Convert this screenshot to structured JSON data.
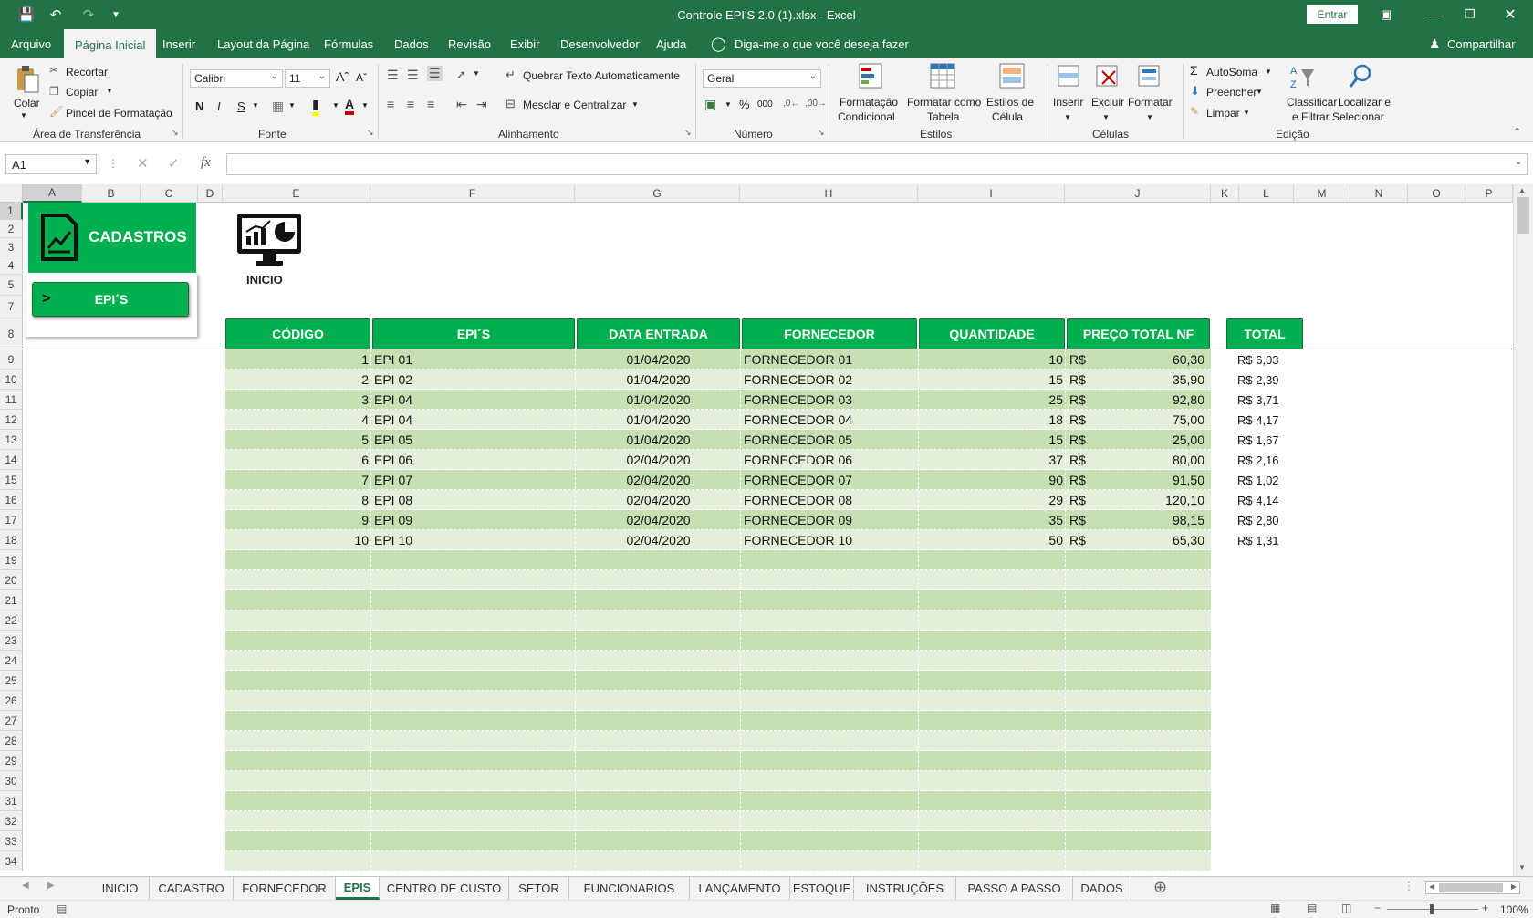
{
  "window": {
    "title": "Controle EPI'S 2.0 (1).xlsx  -  Excel",
    "sign_in": "Entrar"
  },
  "menu": {
    "tabs": [
      "Arquivo",
      "Página Inicial",
      "Inserir",
      "Layout da Página",
      "Fórmulas",
      "Dados",
      "Revisão",
      "Exibir",
      "Desenvolvedor",
      "Ajuda"
    ],
    "active_tab": "Página Inicial",
    "tell_me": "Diga-me o que você deseja fazer",
    "share": "Compartilhar"
  },
  "ribbon": {
    "clipboard": {
      "paste": "Colar",
      "cut": "Recortar",
      "copy": "Copiar",
      "format_painter": "Pincel de Formatação",
      "label": "Área de Transferência"
    },
    "font": {
      "name": "Calibri",
      "size": "11",
      "bold": "N",
      "italic": "I",
      "underline": "S",
      "label": "Fonte"
    },
    "alignment": {
      "wrap_text": "Quebrar Texto Automaticamente",
      "merge_center": "Mesclar e Centralizar",
      "label": "Alinhamento"
    },
    "number": {
      "format": "Geral",
      "percent": "%",
      "thousands": "000",
      "label": "Número"
    },
    "styles": {
      "conditional_1": "Formatação",
      "conditional_2": "Condicional",
      "table_1": "Formatar como",
      "table_2": "Tabela",
      "cell_1": "Estilos de",
      "cell_2": "Célula",
      "label": "Estilos"
    },
    "cells": {
      "insert": "Inserir",
      "delete": "Excluir",
      "format": "Formatar",
      "label": "Células"
    },
    "editing": {
      "autosum": "AutoSoma",
      "fill": "Preencher",
      "clear": "Limpar",
      "sort_1": "Classificar",
      "sort_2": "e Filtrar",
      "find_1": "Localizar e",
      "find_2": "Selecionar",
      "label": "Edição"
    }
  },
  "formula_bar": {
    "name_box": "A1",
    "fx": "fx",
    "value": ""
  },
  "columns": [
    "A",
    "B",
    "C",
    "D",
    "E",
    "F",
    "G",
    "H",
    "I",
    "J",
    "K",
    "L",
    "M",
    "N",
    "O",
    "P"
  ],
  "rows": [
    "1",
    "2",
    "3",
    "4",
    "5",
    "7",
    "8",
    "9",
    "10",
    "11",
    "12",
    "13",
    "14",
    "15",
    "16",
    "17",
    "18",
    "19",
    "20",
    "21",
    "22",
    "23",
    "24",
    "25",
    "26",
    "27",
    "28",
    "29",
    "30",
    "31",
    "32",
    "33",
    "34"
  ],
  "sidebar": {
    "title": "CADASTROS",
    "button_arrow": ">",
    "button_label": "EPI´S"
  },
  "home_button": {
    "label": "INICIO"
  },
  "table": {
    "headers": [
      "CÓDIGO",
      "EPI´S",
      "DATA ENTRADA",
      "FORNECEDOR",
      "QUANTIDADE",
      "PREÇO TOTAL NF"
    ],
    "currency": "R$",
    "rows": [
      {
        "codigo": "1",
        "epi": "EPI 01",
        "data": "01/04/2020",
        "fornecedor": "FORNECEDOR 01",
        "quantidade": "10",
        "preco": "60,30",
        "total": "R$ 6,03"
      },
      {
        "codigo": "2",
        "epi": "EPI 02",
        "data": "01/04/2020",
        "fornecedor": "FORNECEDOR 02",
        "quantidade": "15",
        "preco": "35,90",
        "total": "R$ 2,39"
      },
      {
        "codigo": "3",
        "epi": "EPI 04",
        "data": "01/04/2020",
        "fornecedor": "FORNECEDOR 03",
        "quantidade": "25",
        "preco": "92,80",
        "total": "R$ 3,71"
      },
      {
        "codigo": "4",
        "epi": "EPI 04",
        "data": "01/04/2020",
        "fornecedor": "FORNECEDOR 04",
        "quantidade": "18",
        "preco": "75,00",
        "total": "R$ 4,17"
      },
      {
        "codigo": "5",
        "epi": "EPI 05",
        "data": "01/04/2020",
        "fornecedor": "FORNECEDOR 05",
        "quantidade": "15",
        "preco": "25,00",
        "total": "R$ 1,67"
      },
      {
        "codigo": "6",
        "epi": "EPI 06",
        "data": "02/04/2020",
        "fornecedor": "FORNECEDOR 06",
        "quantidade": "37",
        "preco": "80,00",
        "total": "R$ 2,16"
      },
      {
        "codigo": "7",
        "epi": "EPI 07",
        "data": "02/04/2020",
        "fornecedor": "FORNECEDOR 07",
        "quantidade": "90",
        "preco": "91,50",
        "total": "R$ 1,02"
      },
      {
        "codigo": "8",
        "epi": "EPI 08",
        "data": "02/04/2020",
        "fornecedor": "FORNECEDOR 08",
        "quantidade": "29",
        "preco": "120,10",
        "total": "R$ 4,14"
      },
      {
        "codigo": "9",
        "epi": "EPI 09",
        "data": "02/04/2020",
        "fornecedor": "FORNECEDOR 09",
        "quantidade": "35",
        "preco": "98,15",
        "total": "R$ 2,80"
      },
      {
        "codigo": "10",
        "epi": "EPI 10",
        "data": "02/04/2020",
        "fornecedor": "FORNECEDOR 10",
        "quantidade": "50",
        "preco": "65,30",
        "total": "R$ 1,31"
      }
    ],
    "total_header": "TOTAL"
  },
  "sheet_tabs": [
    "INICIO",
    "CADASTRO",
    "FORNECEDOR",
    "EPIS",
    "CENTRO DE CUSTO",
    "SETOR",
    "FUNCIONARIOS",
    "LANÇAMENTO",
    "ESTOQUE",
    "INSTRUÇÕES",
    "PASSO A PASSO",
    "DADOS"
  ],
  "active_sheet": "EPIS",
  "status": {
    "ready": "Pronto",
    "zoom": "100%"
  },
  "colors": {
    "excel_green": "#217346",
    "table_header": "#00b050",
    "row_fill_a": "#c6e0b4",
    "row_fill_b": "#e2efda"
  }
}
